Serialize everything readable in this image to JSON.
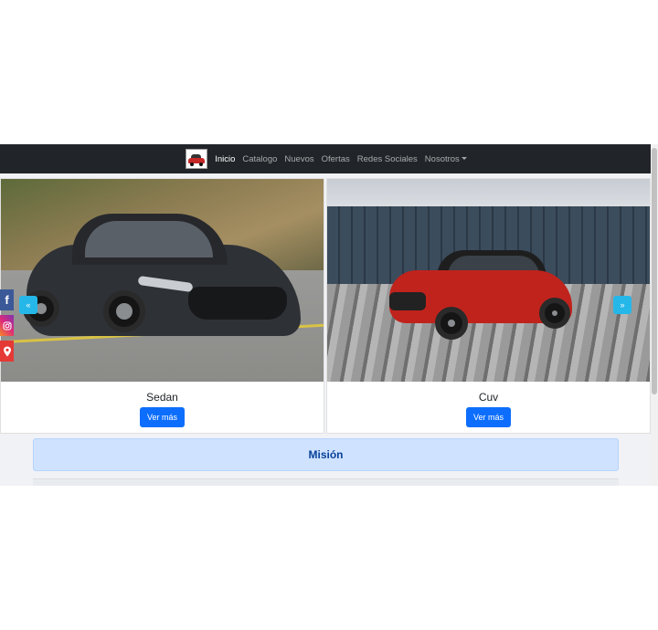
{
  "nav": {
    "brand_alt": "logo",
    "items": [
      {
        "label": "Inicio",
        "active": true
      },
      {
        "label": "Catalogo",
        "active": false
      },
      {
        "label": "Nuevos",
        "active": false
      },
      {
        "label": "Ofertas",
        "active": false
      },
      {
        "label": "Redes Sociales",
        "active": false
      },
      {
        "label": "Nosotros",
        "active": false,
        "dropdown": true
      }
    ]
  },
  "cards": [
    {
      "title": "Sedan",
      "button": "Ver más",
      "image": "dark-gray-sedan"
    },
    {
      "title": "Cuv",
      "button": "Ver más",
      "image": "red-compact-suv"
    }
  ],
  "carousel": {
    "prev_icon": "«",
    "next_icon": "»"
  },
  "social": {
    "facebook": "f",
    "instagram": "instagram-icon",
    "location": "map-pin-icon"
  },
  "mision": {
    "title": "Misión"
  },
  "colors": {
    "navbar": "#212529",
    "primary_button": "#0d6efd",
    "carousel_button": "#25b7e8",
    "alert_bg": "#cfe2ff",
    "alert_text": "#084298"
  }
}
